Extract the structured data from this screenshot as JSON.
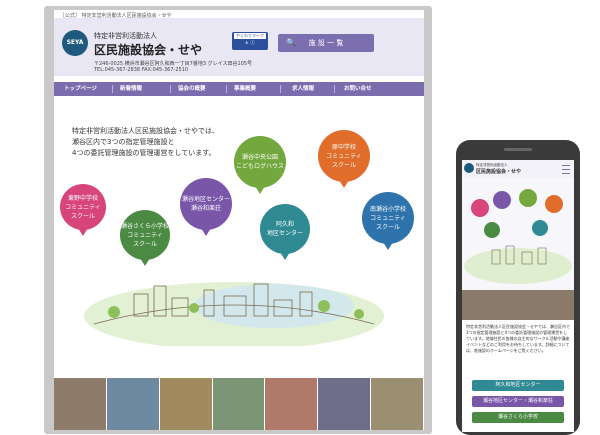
{
  "desktop": {
    "tagline": "［公式］ 特定非営利活動法人区民施設協会・せや",
    "logo_text": "SEYA",
    "org_sub": "特定非営利活動法人",
    "org_name": "区民施設協会・せや",
    "address": "〒246-0025 横浜市瀬谷区阿久和西一丁目7番地3 グレイス田谷105号",
    "phone": "TEL:045-367-2838 FAX:045-367-2510",
    "yakuwari_label": "やくわりマーク",
    "facility_button": "施 設 一 覧",
    "nav": [
      "トップページ",
      "新着情報",
      "協会の概要",
      "事業概要",
      "求人情報",
      "お問い合せ"
    ],
    "intro_lines": [
      "特定非営利活動法人区民施設協会・せやでは、",
      "瀬谷区内で3つの指定管理施設と",
      "4つの委託管理施設の管理運営をしています。"
    ],
    "pins": [
      {
        "lines": [
          "東野中学校",
          "コミュニティ",
          "スクール"
        ],
        "color": "#d8457a"
      },
      {
        "lines": [
          "瀬谷さくら小学校",
          "コミュニティ",
          "スクール"
        ],
        "color": "#4a8a43"
      },
      {
        "lines": [
          "瀬谷地区センター",
          "瀬谷和楽荘"
        ],
        "color": "#7a56a8"
      },
      {
        "lines": [
          "瀬谷中央公園",
          "こどもログハウス"
        ],
        "color": "#72a83d"
      },
      {
        "lines": [
          "阿久和",
          "地区センター"
        ],
        "color": "#2f8a93"
      },
      {
        "lines": [
          "原中学校",
          "コミュニティ",
          "スクール"
        ],
        "color": "#e06d2a"
      },
      {
        "lines": [
          "南瀬谷小学校",
          "コミュニティ",
          "スクール"
        ],
        "color": "#2f73ac"
      }
    ]
  },
  "mobile": {
    "sub": "特定非営利活動法人",
    "name": "区民施設協会・せや",
    "intro": "特定非営利活動法人区民施設協会・せやでは、瀬谷区内で3つの指定管理施設と4つの委託管理施設の管理運営をしています。地域住民の皆様の自主的なサークル活動や講座イベントなどのご利用をお待ちしています。詳細については、各施設のホームページをご覧ください。",
    "buttons": [
      {
        "label": "阿久和地区センター",
        "color": "#2f8a93"
      },
      {
        "label": "瀬谷地区センター・瀬谷和楽荘",
        "color": "#7a56a8"
      },
      {
        "label": "瀬谷さくら小学校",
        "color": "#4a8a43"
      }
    ]
  }
}
